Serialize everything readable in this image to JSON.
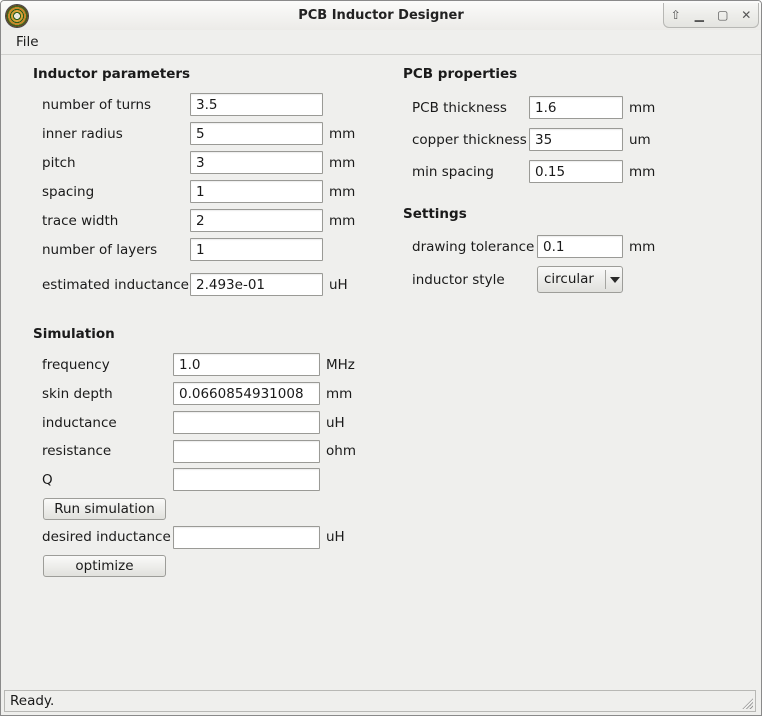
{
  "window": {
    "title": "PCB Inductor Designer"
  },
  "menu": {
    "file": "File"
  },
  "inductor": {
    "title": "Inductor parameters",
    "turns_label": "number of turns",
    "turns_value": "3.5",
    "inner_radius_label": "inner radius",
    "inner_radius_value": "5",
    "inner_radius_unit": "mm",
    "pitch_label": "pitch",
    "pitch_value": "3",
    "pitch_unit": "mm",
    "spacing_label": "spacing",
    "spacing_value": "1",
    "spacing_unit": "mm",
    "trace_width_label": "trace width",
    "trace_width_value": "2",
    "trace_width_unit": "mm",
    "layers_label": "number of layers",
    "layers_value": "1",
    "est_inductance_label": "estimated inductance",
    "est_inductance_value": "2.493e-01",
    "est_inductance_unit": "uH"
  },
  "simulation": {
    "title": "Simulation",
    "frequency_label": "frequency",
    "frequency_value": "1.0",
    "frequency_unit": "MHz",
    "skin_depth_label": "skin depth",
    "skin_depth_value": "0.0660854931008",
    "skin_depth_unit": "mm",
    "inductance_label": "inductance",
    "inductance_value": "",
    "inductance_unit": "uH",
    "resistance_label": "resistance",
    "resistance_value": "",
    "resistance_unit": "ohm",
    "q_label": "Q",
    "q_value": "",
    "run_button": "Run simulation",
    "desired_inductance_label": "desired inductance",
    "desired_inductance_value": "",
    "desired_inductance_unit": "uH",
    "optimize_button": "optimize"
  },
  "pcb": {
    "title": "PCB properties",
    "thickness_label": "PCB thickness",
    "thickness_value": "1.6",
    "thickness_unit": "mm",
    "copper_label": "copper thickness",
    "copper_value": "35",
    "copper_unit": "um",
    "min_spacing_label": "min spacing",
    "min_spacing_value": "0.15",
    "min_spacing_unit": "mm"
  },
  "settings": {
    "title": "Settings",
    "tolerance_label": "drawing tolerance",
    "tolerance_value": "0.1",
    "tolerance_unit": "mm",
    "style_label": "inductor style",
    "style_value": "circular"
  },
  "status": {
    "text": "Ready."
  }
}
